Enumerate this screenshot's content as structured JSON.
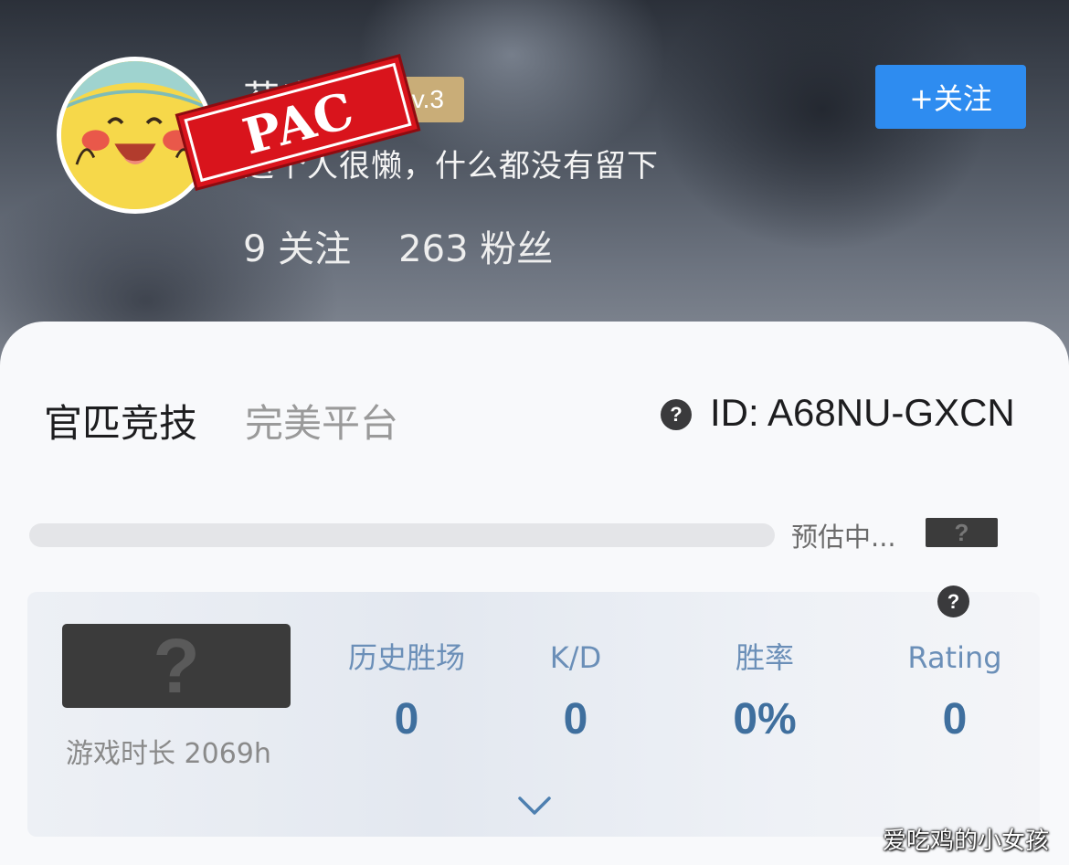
{
  "profile": {
    "username": "芬表",
    "level": "Lv.3",
    "bio": "这个人很懒，什么都没有留下",
    "following_count": "9",
    "following_label": "关注",
    "followers_count": "263",
    "followers_label": "粉丝",
    "follow_button": "+关注",
    "stamp_text": "PAC"
  },
  "tabs": [
    {
      "label": "官匹竞技",
      "active": true
    },
    {
      "label": "完美平台",
      "active": false
    }
  ],
  "player": {
    "id_help_icon": "?",
    "id_text": "ID: A68NU-GXCN"
  },
  "rank_progress": {
    "fill_fraction": 0,
    "estimating_text": "预估中...",
    "rank_badge": "?"
  },
  "stats": {
    "help_icon": "?",
    "rank_badge": "?",
    "playtime": "游戏时长 2069h",
    "columns": [
      {
        "label": "历史胜场",
        "value": "0"
      },
      {
        "label": "K/D",
        "value": "0"
      },
      {
        "label": "胜率",
        "value": "0%"
      },
      {
        "label": "Rating",
        "value": "0"
      }
    ]
  },
  "watermark": "爱吃鸡的小女孩",
  "colors": {
    "accent_blue": "#2e8cf0",
    "level_gold": "#c9ad78",
    "stamp_red": "#d9141c",
    "stat_value": "#3f6f9e",
    "stat_label": "#6b8fb8"
  }
}
